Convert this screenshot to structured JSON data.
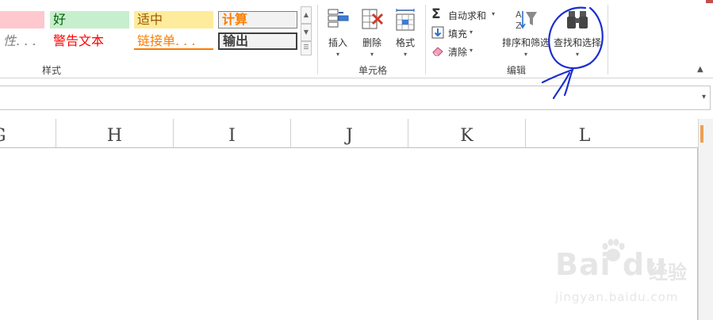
{
  "styles_group": {
    "label": "样式",
    "cells": [
      {
        "id": "bad",
        "text": "",
        "bg": "#ffc7ce",
        "fg": "#9c0006"
      },
      {
        "id": "good",
        "text": "好",
        "bg": "#c6efce",
        "fg": "#006100"
      },
      {
        "id": "neutral",
        "text": "适中",
        "bg": "#ffeb9c",
        "fg": "#9c5700"
      },
      {
        "id": "calculation",
        "text": "计算",
        "bg": "#f2f2f2",
        "fg": "#fa7d00"
      },
      {
        "id": "explanatory",
        "text": "性. . .",
        "bg": "#ffffff",
        "fg": "#7f7f7f"
      },
      {
        "id": "warning",
        "text": "警告文本",
        "bg": "#ffffff",
        "fg": "#ff0000"
      },
      {
        "id": "linked",
        "text": "链接单. . .",
        "bg": "#ffffff",
        "fg": "#fa7d00"
      },
      {
        "id": "output",
        "text": "输出",
        "bg": "#f2f2f2",
        "fg": "#3f3f3f"
      }
    ]
  },
  "cells_group": {
    "label": "单元格",
    "insert": "插入",
    "delete": "删除",
    "format": "格式"
  },
  "editing_group": {
    "label": "编辑",
    "autosum": "自动求和",
    "fill": "填充",
    "clear": "清除",
    "sort_filter": "排序和筛选",
    "find_select": "查找和选择"
  },
  "columns": [
    "G",
    "H",
    "I",
    "J",
    "K",
    "L"
  ],
  "watermark": {
    "brand": "Bai du",
    "cn": "经验",
    "url": "jingyan.baidu.com"
  },
  "colors": {
    "annotation": "#1a2ed0",
    "accent_orange": "#f0a050"
  }
}
